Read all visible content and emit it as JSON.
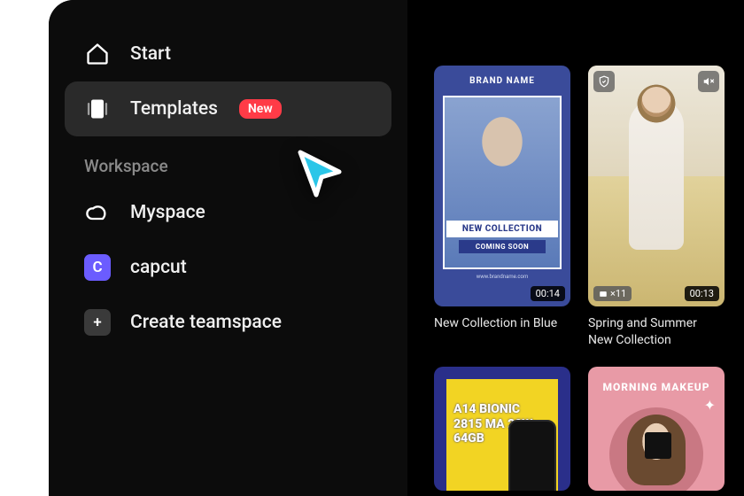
{
  "sidebar": {
    "items": [
      {
        "label": "Start"
      },
      {
        "label": "Templates",
        "badge": "New"
      }
    ],
    "section_label": "Workspace",
    "workspaces": [
      {
        "label": "Myspace"
      },
      {
        "label": "capcut",
        "initial": "C"
      },
      {
        "label": "Create teamspace",
        "initial": "+"
      }
    ]
  },
  "templates": [
    {
      "title": "New Collection in Blue",
      "duration": "00:14",
      "overlay_brand": "BRAND NAME",
      "overlay_line1": "NEW COLLECTION",
      "overlay_line2": "COMING SOON",
      "overlay_site": "www.brandname.com"
    },
    {
      "title": "Spring and Summer New Collection",
      "duration": "00:13",
      "clip_count": "×11"
    },
    {
      "overlay_text": "A14 BIONIC\n2815 MA 20W\n64GB"
    },
    {
      "overlay_header": "MORNING MAKEUP"
    }
  ]
}
